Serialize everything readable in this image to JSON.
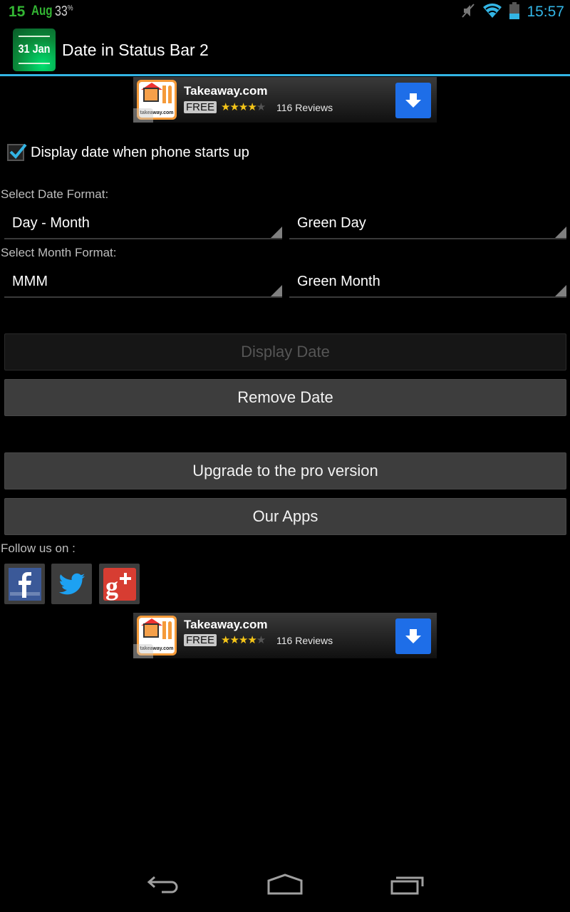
{
  "status_bar": {
    "day": "15",
    "month": "Aug",
    "battery_percent": "33",
    "battery_unit": "%",
    "time": "15:57",
    "icons": [
      "mute-icon",
      "wifi-icon",
      "battery-icon"
    ]
  },
  "action_bar": {
    "app_icon_text": "31 Jan",
    "title": "Date in Status Bar 2",
    "accent_color": "#33b5e5"
  },
  "ads": [
    {
      "brand_text": "takeaway.com",
      "title": "Takeaway.com",
      "price_badge": "FREE",
      "rating": 4,
      "rating_max": 5,
      "stars": "★★★★",
      "stars_off": "★",
      "reviews": "116 Reviews"
    },
    {
      "brand_text": "takeaway.com",
      "title": "Takeaway.com",
      "price_badge": "FREE",
      "rating": 4,
      "rating_max": 5,
      "stars": "★★★★",
      "stars_off": "★",
      "reviews": "116 Reviews"
    }
  ],
  "settings": {
    "startup_checkbox": {
      "label": "Display date when phone starts up",
      "checked": true
    },
    "date_format_label": "Select Date Format:",
    "date_format_value": "Day - Month",
    "date_color_value": "Green Day",
    "month_format_label": "Select Month Format:",
    "month_format_value": "MMM",
    "month_color_value": "Green Month"
  },
  "buttons": {
    "display_date": "Display Date",
    "remove_date": "Remove Date",
    "upgrade": "Upgrade to the pro version",
    "our_apps": "Our Apps"
  },
  "social": {
    "label": "Follow us on :",
    "items": [
      {
        "name": "facebook",
        "color": "#3b5998"
      },
      {
        "name": "twitter",
        "color": "#1da1f2"
      },
      {
        "name": "google-plus",
        "color": "#d73d32"
      }
    ]
  },
  "nav_bar": {
    "buttons": [
      "back",
      "home",
      "recent-apps"
    ]
  }
}
